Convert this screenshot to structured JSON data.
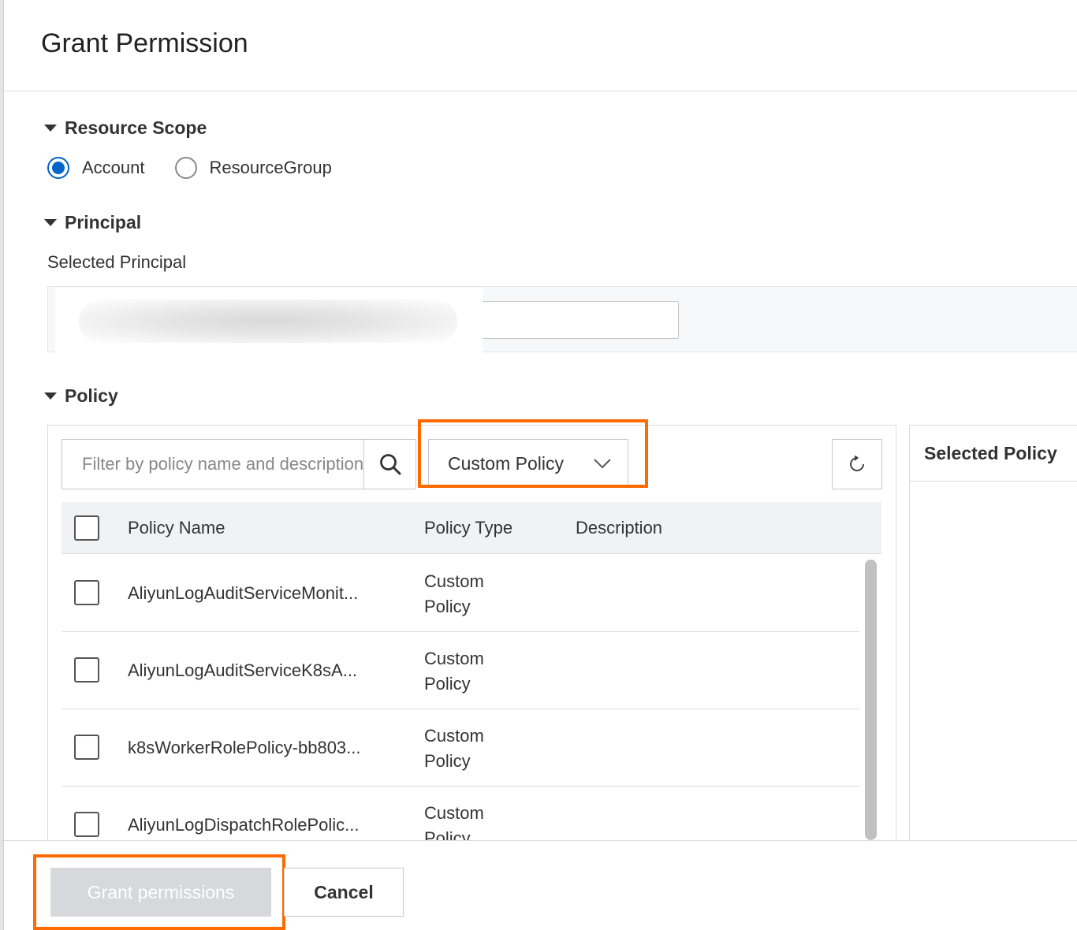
{
  "dialog": {
    "title": "Grant Permission"
  },
  "resource_scope": {
    "heading": "Resource Scope",
    "options": [
      {
        "label": "Account",
        "selected": true
      },
      {
        "label": "ResourceGroup",
        "selected": false
      }
    ]
  },
  "principal": {
    "heading": "Principal",
    "selected_label": "Selected Principal",
    "input_value": ""
  },
  "policy": {
    "heading": "Policy",
    "search_placeholder": "Filter by policy name and description",
    "type_filter": "Custom Policy",
    "columns": [
      "Policy Name",
      "Policy Type",
      "Description"
    ],
    "rows": [
      {
        "name": "AliyunLogAuditServiceMonit...",
        "type_line1": "Custom",
        "type_line2": "Policy",
        "description": ""
      },
      {
        "name": "AliyunLogAuditServiceK8sA...",
        "type_line1": "Custom",
        "type_line2": "Policy",
        "description": ""
      },
      {
        "name": "k8sWorkerRolePolicy-bb803...",
        "type_line1": "Custom",
        "type_line2": "Policy",
        "description": ""
      },
      {
        "name": "AliyunLogDispatchRolePolic...",
        "type_line1": "Custom",
        "type_line2": "Policy",
        "description": ""
      }
    ],
    "selected_panel_title": "Selected Policy"
  },
  "footer": {
    "grant_label": "Grant permissions",
    "cancel_label": "Cancel"
  },
  "colors": {
    "accent": "#0064c8",
    "highlight": "#ff6a00",
    "disabled_button": "#d7d8dc"
  },
  "icons": {
    "search": "search-icon",
    "dropdown": "chevron-down-icon",
    "refresh": "refresh-icon",
    "section_toggle": "caret-down-icon"
  }
}
